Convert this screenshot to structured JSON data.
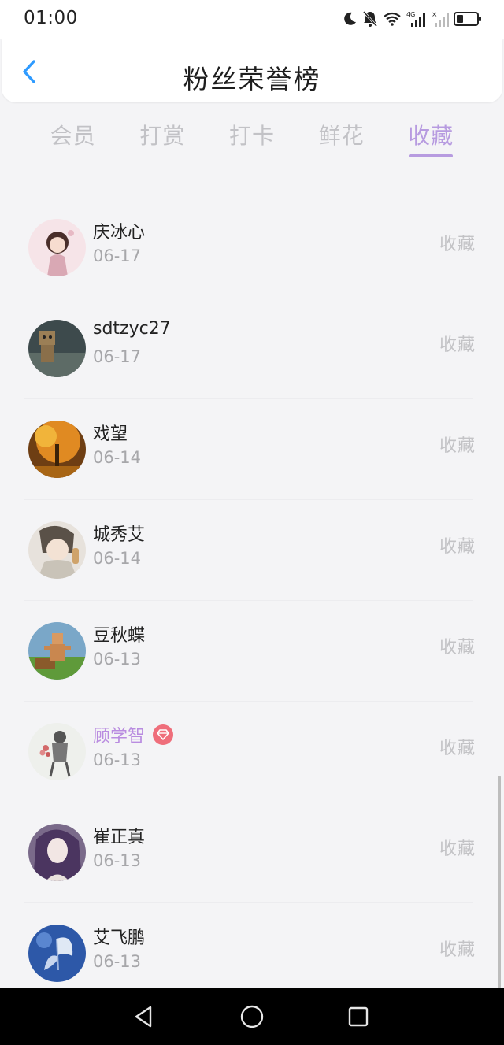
{
  "status_bar": {
    "time": "01:00",
    "icons": [
      "moon-icon",
      "mute-bell-icon",
      "wifi-icon",
      "signal-4g-icon",
      "signal-no-service-icon",
      "battery-icon"
    ],
    "network_label": "4G"
  },
  "header": {
    "back_icon": "chevron-left-icon",
    "title": "粉丝荣誉榜"
  },
  "tabs": [
    {
      "label": "会员",
      "active": false
    },
    {
      "label": "打赏",
      "active": false
    },
    {
      "label": "打卡",
      "active": false
    },
    {
      "label": "鲜花",
      "active": false
    },
    {
      "label": "收藏",
      "active": true
    }
  ],
  "colors": {
    "accent": "#b79be0",
    "vip_name": "#b98ce0",
    "vip_badge": "#ef6e7b"
  },
  "fans": [
    {
      "name": "庆冰心",
      "date": "06-17",
      "action": "收藏",
      "vip": false
    },
    {
      "name": "sdtzyc27",
      "date": "06-17",
      "action": "收藏",
      "vip": false
    },
    {
      "name": "戏望",
      "date": "06-14",
      "action": "收藏",
      "vip": false
    },
    {
      "name": "城秀艾",
      "date": "06-14",
      "action": "收藏",
      "vip": false
    },
    {
      "name": "豆秋蝶",
      "date": "06-13",
      "action": "收藏",
      "vip": false
    },
    {
      "name": "顾学智",
      "date": "06-13",
      "action": "收藏",
      "vip": true
    },
    {
      "name": "崔正真",
      "date": "06-13",
      "action": "收藏",
      "vip": false
    },
    {
      "name": "艾飞鹏",
      "date": "06-13",
      "action": "收藏",
      "vip": false
    }
  ],
  "nav_bar": {
    "buttons": [
      "back-triangle-icon",
      "home-circle-icon",
      "recents-square-icon"
    ]
  }
}
